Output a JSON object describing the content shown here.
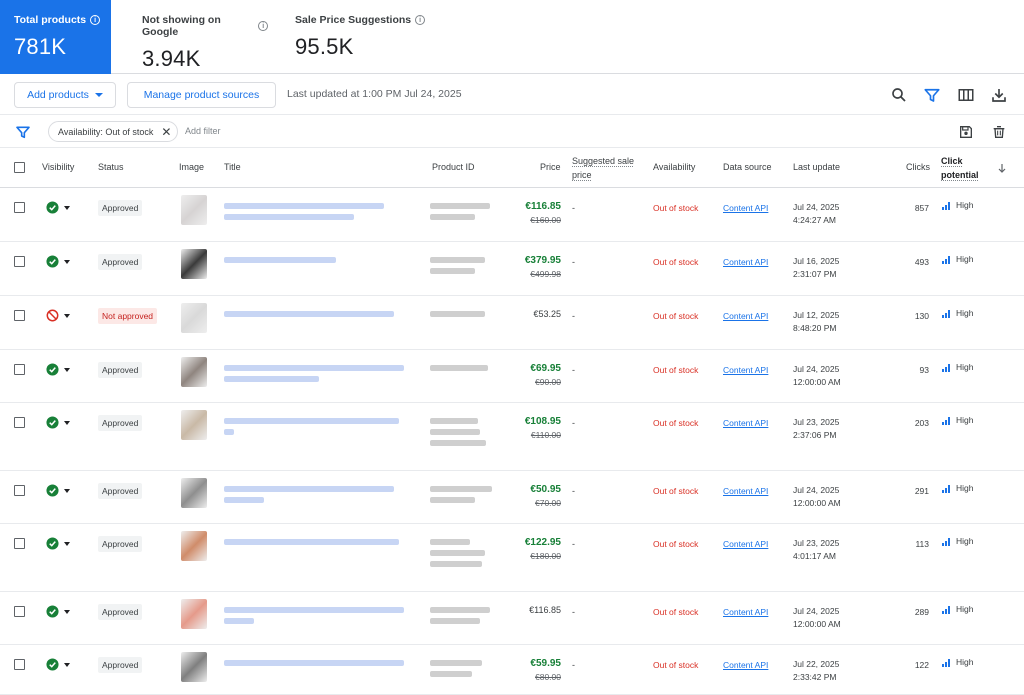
{
  "summary": {
    "total": {
      "label": "Total products",
      "value": "781K"
    },
    "not_showing": {
      "label": "Not showing on Google",
      "value": "3.94K"
    },
    "sale_price": {
      "label": "Sale Price Suggestions",
      "value": "95.5K"
    }
  },
  "toolbar": {
    "add_products": "Add products",
    "manage_sources": "Manage product sources",
    "last_updated": "Last updated at 1:00 PM Jul 24, 2025",
    "icons": [
      "search-icon",
      "filter-icon",
      "columns-icon",
      "download-icon"
    ]
  },
  "filterbar": {
    "chip": "Availability: Out of stock",
    "add_filter": "Add filter",
    "icons": [
      "filter-icon",
      "save-icon",
      "delete-icon"
    ]
  },
  "table": {
    "headers": {
      "visibility": "Visibility",
      "status": "Status",
      "image": "Image",
      "title": "Title",
      "product_id": "Product ID",
      "price": "Price",
      "suggested_1": "Suggested sale",
      "suggested_2": "price",
      "availability": "Availability",
      "data_source": "Data source",
      "last_update": "Last update",
      "clicks": "Clicks",
      "potential_1": "Click",
      "potential_2": "potential"
    },
    "rows": [
      {
        "visibility": "visible",
        "status": "Approved",
        "price": "€116.85",
        "old_price": "€160.00",
        "suggested": "-",
        "availability": "Out of stock",
        "data_source": "Content API",
        "date": "Jul 24, 2025",
        "time": "4:24:27 AM",
        "clicks": "857",
        "potential": "High"
      },
      {
        "visibility": "visible",
        "status": "Approved",
        "price": "€379.95",
        "old_price": "€499.98",
        "suggested": "-",
        "availability": "Out of stock",
        "data_source": "Content API",
        "date": "Jul 16, 2025",
        "time": "2:31:07 PM",
        "clicks": "493",
        "potential": "High"
      },
      {
        "visibility": "blocked",
        "status": "Not approved",
        "price": "€53.25",
        "old_price": "",
        "suggested": "-",
        "availability": "Out of stock",
        "data_source": "Content API",
        "date": "Jul 12, 2025",
        "time": "8:48:20 PM",
        "clicks": "130",
        "potential": "High"
      },
      {
        "visibility": "visible",
        "status": "Approved",
        "price": "€69.95",
        "old_price": "€90.00",
        "suggested": "-",
        "availability": "Out of stock",
        "data_source": "Content API",
        "date": "Jul 24, 2025",
        "time": "12:00:00 AM",
        "clicks": "93",
        "potential": "High"
      },
      {
        "visibility": "visible",
        "status": "Approved",
        "price": "€108.95",
        "old_price": "€110.00",
        "suggested": "-",
        "availability": "Out of stock",
        "data_source": "Content API",
        "date": "Jul 23, 2025",
        "time": "2:37:06 PM",
        "clicks": "203",
        "potential": "High"
      },
      {
        "visibility": "visible",
        "status": "Approved",
        "price": "€50.95",
        "old_price": "€70.00",
        "suggested": "-",
        "availability": "Out of stock",
        "data_source": "Content API",
        "date": "Jul 24, 2025",
        "time": "12:00:00 AM",
        "clicks": "291",
        "potential": "High"
      },
      {
        "visibility": "visible",
        "status": "Approved",
        "price": "€122.95",
        "old_price": "€180.00",
        "suggested": "-",
        "availability": "Out of stock",
        "data_source": "Content API",
        "date": "Jul 23, 2025",
        "time": "4:01:17 AM",
        "clicks": "113",
        "potential": "High"
      },
      {
        "visibility": "visible",
        "status": "Approved",
        "price": "€116.85",
        "old_price": "",
        "suggested": "-",
        "availability": "Out of stock",
        "data_source": "Content API",
        "date": "Jul 24, 2025",
        "time": "12:00:00 AM",
        "clicks": "289",
        "potential": "High"
      },
      {
        "visibility": "visible",
        "status": "Approved",
        "price": "€59.95",
        "old_price": "€80.00",
        "suggested": "-",
        "availability": "Out of stock",
        "data_source": "Content API",
        "date": "Jul 22, 2025",
        "time": "2:33:42 PM",
        "clicks": "122",
        "potential": "High"
      }
    ]
  },
  "colors": {
    "accent": "#1a73e8",
    "approved": "#188038",
    "error": "#d93025"
  }
}
